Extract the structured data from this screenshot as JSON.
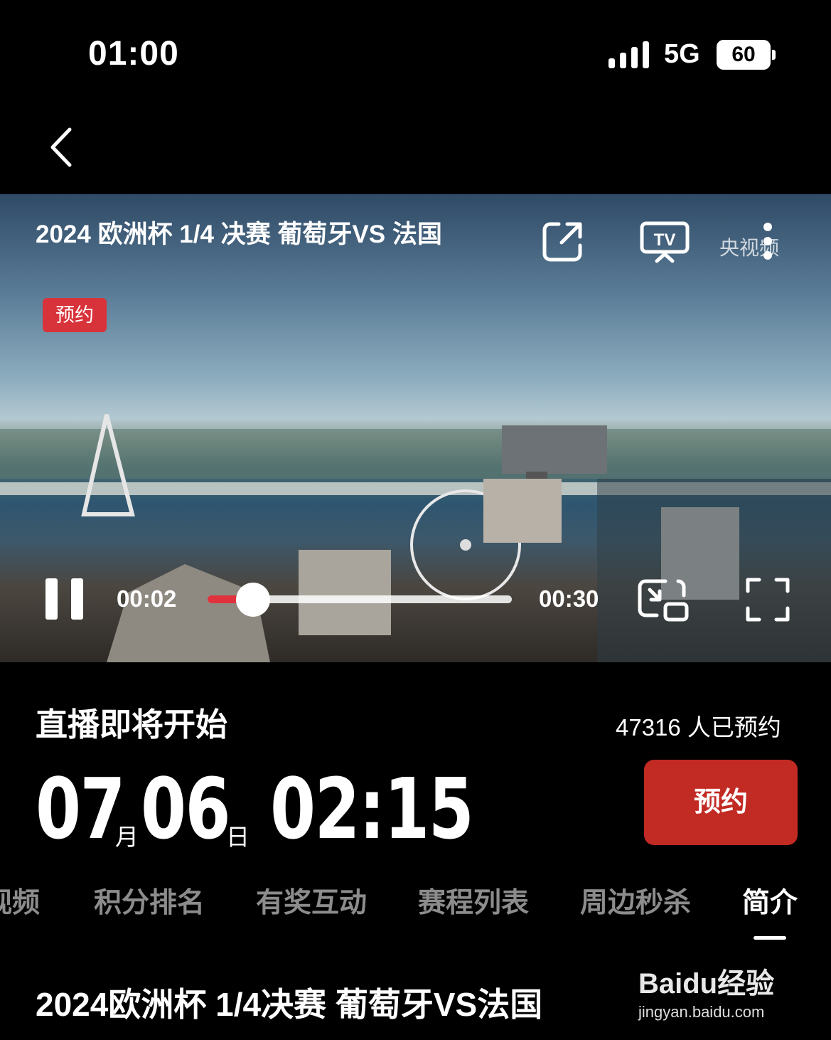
{
  "status_bar": {
    "time": "01:00",
    "network": "5G",
    "battery": "60"
  },
  "video": {
    "title": "2024 欧洲杯 1/4 决赛 葡萄牙VS 法国",
    "badge": "预约",
    "watermark": "央视频",
    "current_time": "00:02",
    "duration": "00:30",
    "progress_fraction": 0.15
  },
  "info": {
    "status": "直播即将开始",
    "reserve_count": "47316 人已预约",
    "month": "07",
    "month_unit": "月",
    "day": "06",
    "day_unit": "日",
    "time": "02:15",
    "reserve_button": "预约"
  },
  "tabs": [
    {
      "label": "视频"
    },
    {
      "label": "积分排名"
    },
    {
      "label": "有奖互动"
    },
    {
      "label": "赛程列表"
    },
    {
      "label": "周边秒杀"
    },
    {
      "label": "简介",
      "active": true
    }
  ],
  "intro": {
    "title": "2024欧洲杯 1/4决赛 葡萄牙VS法国"
  },
  "watermark": {
    "brand": "Baidu经验",
    "url": "jingyan.baidu.com"
  }
}
